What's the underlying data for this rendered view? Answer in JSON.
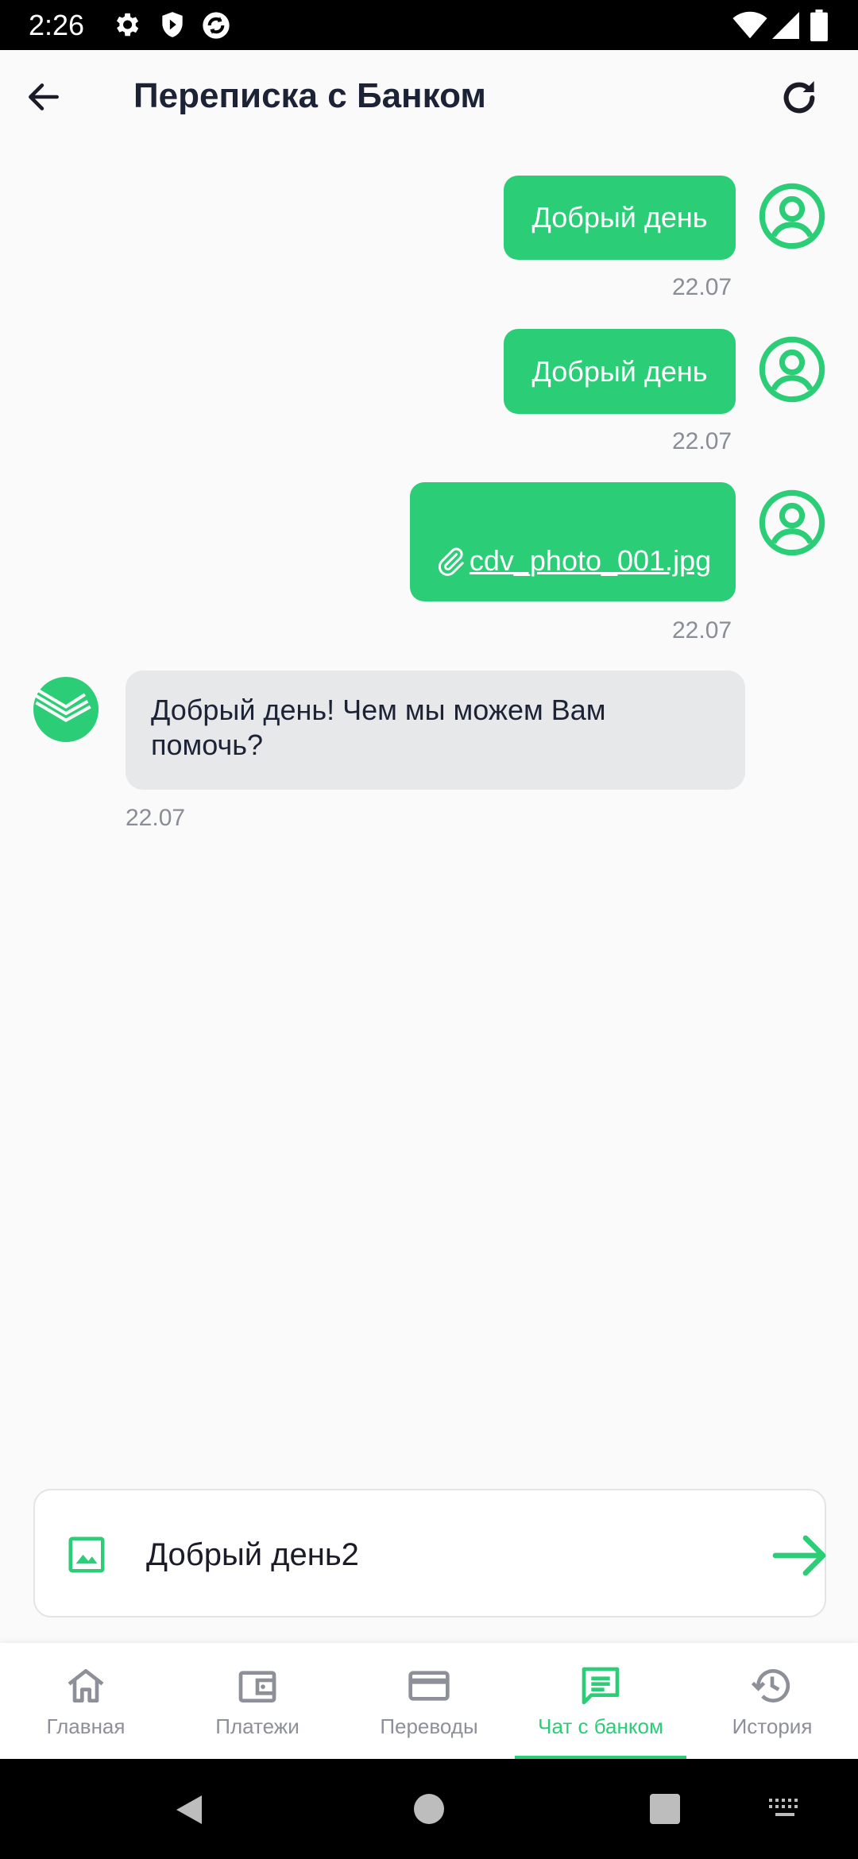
{
  "status_bar": {
    "time": "2:26",
    "icons": [
      "settings-icon",
      "shield-icon",
      "sync-icon",
      "wifi-icon",
      "cellular-icon",
      "battery-icon"
    ]
  },
  "app_bar": {
    "title": "Переписка с Банком",
    "back_icon": "arrow-left-icon",
    "refresh_icon": "refresh-icon"
  },
  "messages": [
    {
      "direction": "out",
      "text": "Добрый день",
      "date": "22.07"
    },
    {
      "direction": "out",
      "text": "Добрый день",
      "date": "22.07"
    },
    {
      "direction": "out",
      "attachment": "cdv_photo_001.jpg",
      "date": "22.07"
    },
    {
      "direction": "in",
      "text": "Добрый день! Чем мы можем Вам помочь?",
      "date": "22.07"
    }
  ],
  "composer": {
    "value": "Добрый день2",
    "attach_icon": "image-icon",
    "send_icon": "arrow-right-icon"
  },
  "bottom_nav": {
    "items": [
      {
        "label": "Главная",
        "icon": "home-icon",
        "active": false
      },
      {
        "label": "Платежи",
        "icon": "wallet-icon",
        "active": false
      },
      {
        "label": "Переводы",
        "icon": "card-icon",
        "active": false
      },
      {
        "label": "Чат с банком",
        "icon": "chat-icon",
        "active": true
      },
      {
        "label": "История",
        "icon": "history-icon",
        "active": false
      }
    ]
  },
  "colors": {
    "accent": "#2ccd77",
    "incoming_bubble": "#e7e8ea",
    "background": "#fafafa",
    "title_text": "#1d2336",
    "muted_text": "#8a8d96"
  }
}
